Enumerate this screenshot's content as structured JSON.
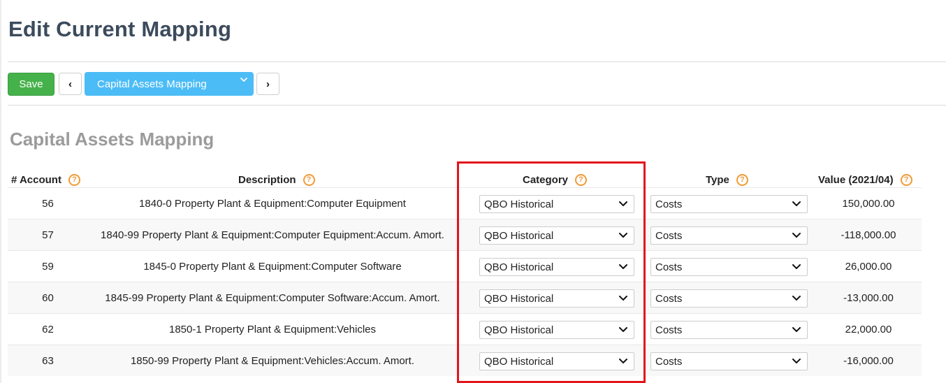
{
  "page": {
    "title": "Edit Current Mapping"
  },
  "toolbar": {
    "save_label": "Save",
    "prev_glyph": "‹",
    "next_glyph": "›",
    "mapping_selected": "Capital Assets Mapping"
  },
  "section": {
    "title": "Capital Assets Mapping"
  },
  "table": {
    "headers": {
      "account": "# Account",
      "description": "Description",
      "category": "Category",
      "type": "Type",
      "value": "Value (2021/04)"
    },
    "help_glyph": "?",
    "rows": [
      {
        "account": "56",
        "description": "1840-0 Property Plant & Equipment:Computer Equipment",
        "category": "QBO Historical",
        "type": "Costs",
        "value": "150,000.00"
      },
      {
        "account": "57",
        "description": "1840-99 Property Plant & Equipment:Computer Equipment:Accum. Amort.",
        "category": "QBO Historical",
        "type": "Costs",
        "value": "-118,000.00"
      },
      {
        "account": "59",
        "description": "1845-0 Property Plant & Equipment:Computer Software",
        "category": "QBO Historical",
        "type": "Costs",
        "value": "26,000.00"
      },
      {
        "account": "60",
        "description": "1845-99 Property Plant & Equipment:Computer Software:Accum. Amort.",
        "category": "QBO Historical",
        "type": "Costs",
        "value": "-13,000.00"
      },
      {
        "account": "62",
        "description": "1850-1 Property Plant & Equipment:Vehicles",
        "category": "QBO Historical",
        "type": "Costs",
        "value": "22,000.00"
      },
      {
        "account": "63",
        "description": "1850-99 Property Plant & Equipment:Vehicles:Accum. Amort.",
        "category": "QBO Historical",
        "type": "Costs",
        "value": "-16,000.00"
      }
    ]
  },
  "colors": {
    "save_green": "#45b14a",
    "select_blue": "#4cbcf6",
    "help_orange": "#f29b34",
    "highlight_red": "#e3141b",
    "title_slate": "#3c4b5c"
  },
  "icons": {
    "help": "question-circle-icon",
    "prev": "chevron-left-icon",
    "next": "chevron-right-icon",
    "dropdown": "chevron-down-icon"
  }
}
